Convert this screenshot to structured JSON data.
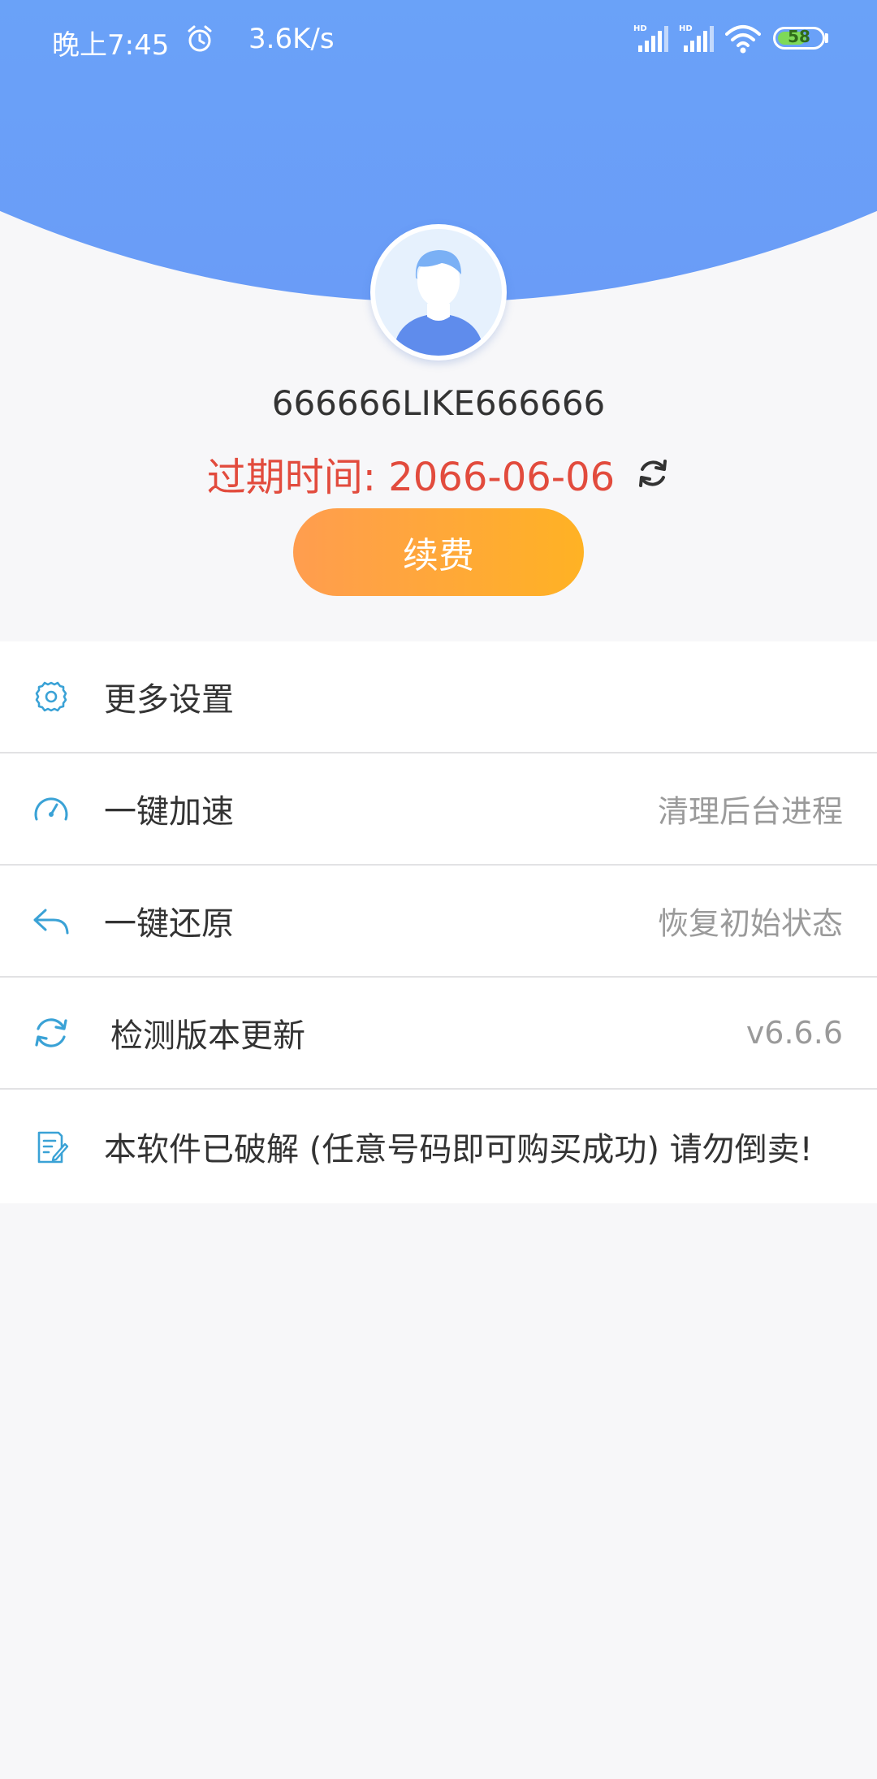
{
  "status_bar": {
    "time": "晚上7:45",
    "speed": "3.6K/s",
    "signal1_label": "HD",
    "signal2_label": "HD",
    "battery": "58",
    "alarm_icon": "alarm-clock-icon",
    "wifi_icon": "wifi-icon"
  },
  "profile": {
    "username": "666666LIKE666666",
    "expire_label": "过期时间: 2066-06-06",
    "renew_label": "续费"
  },
  "menu": {
    "items": [
      {
        "label": "更多设置",
        "sub": "",
        "icon": "gear-icon"
      },
      {
        "label": "一键加速",
        "sub": "清理后台进程",
        "icon": "speedometer-icon"
      },
      {
        "label": "一键还原",
        "sub": "恢复初始状态",
        "icon": "undo-arrow-icon"
      },
      {
        "label": "检测版本更新",
        "sub": "v6.6.6",
        "icon": "sync-icon"
      },
      {
        "label": "本软件已破解 (任意号码即可购买成功) 请勿倒卖!",
        "sub": "",
        "icon": "note-edit-icon"
      }
    ]
  },
  "colors": {
    "header_top": "#62d7f3",
    "header_bottom": "#6a9cf7",
    "expire_red": "#e24b3d",
    "button_orange_start": "#ff9d4f",
    "button_orange_end": "#ffb224",
    "icon_blue": "#3aa2d6"
  }
}
